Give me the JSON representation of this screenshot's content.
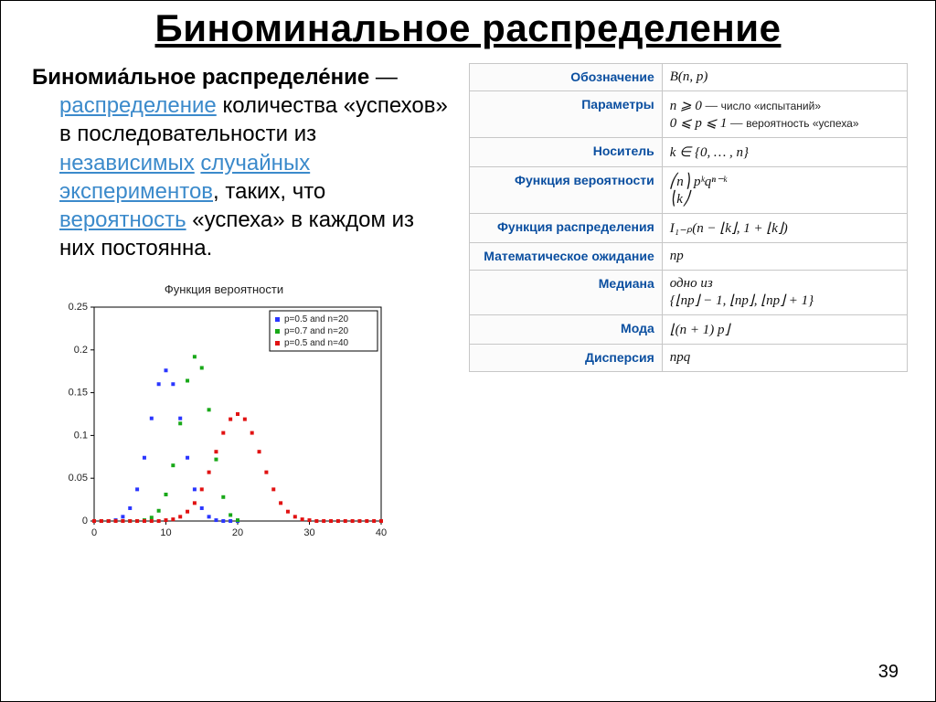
{
  "title": "Биноминальное распределение",
  "intro": {
    "strong": "Биномиа́льное распределе́ние",
    "sep": "  —  ",
    "link1": "распределение",
    "t1": " количества «успехов» в последовательности из   ",
    "link2": "независимых",
    "sp": " ",
    "link3": "случайных экспериментов",
    "t2": ", таких, что ",
    "link4": "вероятность",
    "t3": " «успеха» в каждом из них постоянна."
  },
  "chart_data": {
    "type": "scatter",
    "title": "Функция вероятности",
    "xlim": [
      0,
      40
    ],
    "ylim": [
      0,
      0.25
    ],
    "xticks": [
      0,
      10,
      20,
      30,
      40
    ],
    "yticks": [
      0,
      0.05,
      0.1,
      0.15,
      0.2,
      0.25
    ],
    "series": [
      {
        "name": "p=0.5 and n=20",
        "color": "#2a36ff",
        "p": 0.5,
        "n": 20,
        "x": [
          0,
          1,
          2,
          3,
          4,
          5,
          6,
          7,
          8,
          9,
          10,
          11,
          12,
          13,
          14,
          15,
          16,
          17,
          18,
          19,
          20
        ],
        "y": [
          0,
          0,
          0,
          0.001,
          0.005,
          0.015,
          0.037,
          0.074,
          0.12,
          0.16,
          0.176,
          0.16,
          0.12,
          0.074,
          0.037,
          0.015,
          0.005,
          0.001,
          0,
          0,
          0
        ]
      },
      {
        "name": "p=0.7 and n=20",
        "color": "#18a818",
        "p": 0.7,
        "n": 20,
        "x": [
          0,
          1,
          2,
          3,
          4,
          5,
          6,
          7,
          8,
          9,
          10,
          11,
          12,
          13,
          14,
          15,
          16,
          17,
          18,
          19,
          20
        ],
        "y": [
          0,
          0,
          0,
          0,
          0,
          0,
          0,
          0.001,
          0.004,
          0.012,
          0.031,
          0.065,
          0.114,
          0.164,
          0.192,
          0.179,
          0.13,
          0.072,
          0.028,
          0.007,
          0.001
        ]
      },
      {
        "name": "p=0.5 and n=40",
        "color": "#e11212",
        "p": 0.5,
        "n": 40,
        "x": [
          0,
          1,
          2,
          3,
          4,
          5,
          6,
          7,
          8,
          9,
          10,
          11,
          12,
          13,
          14,
          15,
          16,
          17,
          18,
          19,
          20,
          21,
          22,
          23,
          24,
          25,
          26,
          27,
          28,
          29,
          30,
          31,
          32,
          33,
          34,
          35,
          36,
          37,
          38,
          39,
          40
        ],
        "y": [
          0,
          0,
          0,
          0,
          0,
          0,
          0,
          0,
          0,
          0,
          0.001,
          0.002,
          0.005,
          0.011,
          0.021,
          0.037,
          0.057,
          0.081,
          0.103,
          0.119,
          0.125,
          0.119,
          0.103,
          0.081,
          0.057,
          0.037,
          0.021,
          0.011,
          0.005,
          0.002,
          0.001,
          0,
          0,
          0,
          0,
          0,
          0,
          0,
          0,
          0,
          0
        ]
      }
    ]
  },
  "table": {
    "rows": [
      {
        "label": "Обозначение",
        "value": "B(n, p)"
      },
      {
        "label": "Параметры",
        "value": "n ⩾ 0 — ",
        "note1": "число «испытаний»",
        "value2": "0 ⩽ p ⩽ 1 — ",
        "note2": "вероятность «успеха»"
      },
      {
        "label": "Носитель",
        "value": "k ∈ {0, … , n}"
      },
      {
        "label": "Функция вероятности",
        "value": "⎛n⎞  pᵏqⁿ⁻ᵏ",
        "value2": "⎝k⎠"
      },
      {
        "label": "Функция распределения",
        "value": "I₁₋ₚ(n − ⌊k⌋, 1 + ⌊k⌋)"
      },
      {
        "label": "Математическое ожидание",
        "value": "np"
      },
      {
        "label": "Медиана",
        "value": "одно из",
        "value2": "{⌊np⌋ − 1, ⌊np⌋, ⌊np⌋ + 1}"
      },
      {
        "label": "Мода",
        "value": "⌊(n + 1) p⌋"
      },
      {
        "label": "Дисперсия",
        "value": "npq"
      }
    ]
  },
  "page_number": "39"
}
